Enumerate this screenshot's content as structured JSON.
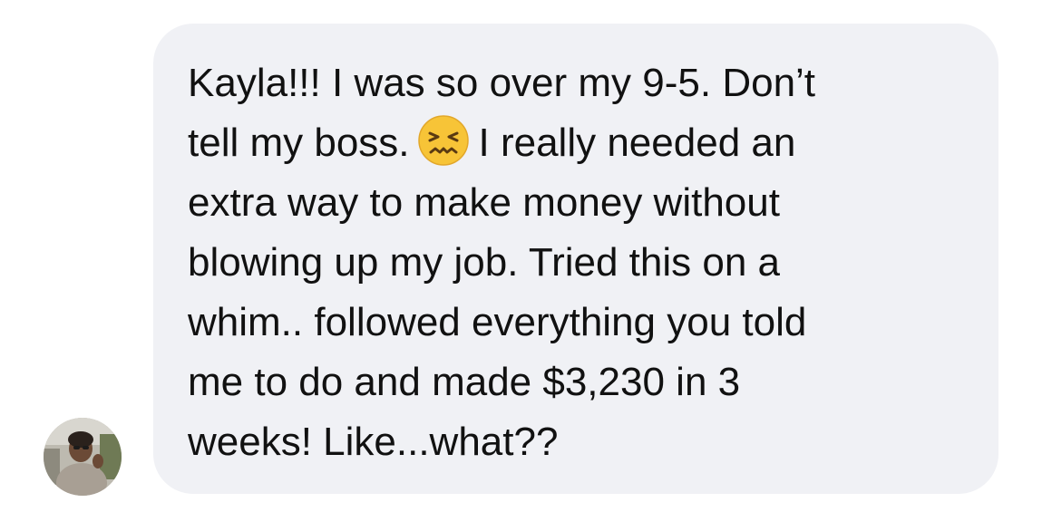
{
  "message": {
    "sender_avatar_icon": "user-photo-avatar",
    "lines": [
      "Kayla!!! I was so over my 9-5. Don’t",
      "tell my boss.",
      "I really needed an",
      "extra way to make money without",
      "blowing up my job. Tried this on a",
      "whim.. followed everything you told",
      "me to do and made $3,230 in 3",
      "weeks! Like...what??"
    ],
    "emoji_icon": "confounded-face-emoji"
  },
  "colors": {
    "bubble_background": "#f0f1f5",
    "text": "#111111",
    "emoji_yellow": "#f7c437"
  }
}
